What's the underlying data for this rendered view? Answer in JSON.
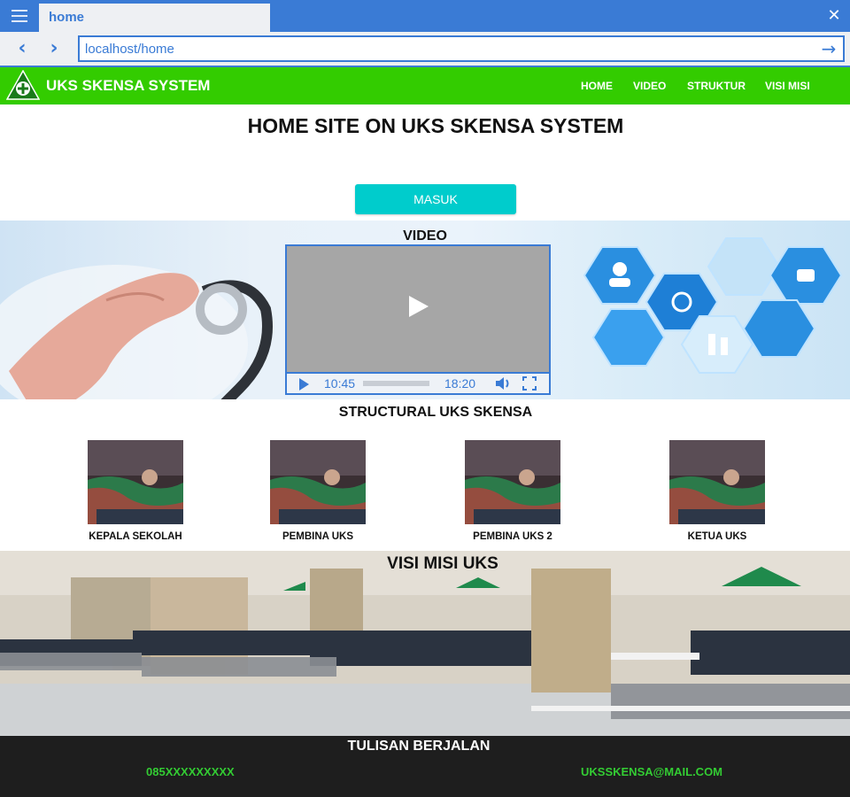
{
  "browser": {
    "tab_title": "home",
    "url": "localhost/home",
    "close_glyph": "✕",
    "back_glyph": "‹",
    "forward_glyph": "›",
    "go_glyph": "→"
  },
  "site": {
    "brand": "UKS SKENSA SYSTEM",
    "logo_text": "UKS",
    "nav": [
      "HOME",
      "VIDEO",
      "STRUKTUR",
      "VISI MISI"
    ]
  },
  "hero": {
    "title": "HOME SITE ON UKS SKENSA SYSTEM",
    "button_label": "MASUK"
  },
  "video": {
    "title": "VIDEO",
    "current_time": "10:45",
    "duration": "18:20",
    "progress": 0
  },
  "structure": {
    "title": "STRUCTURAL UKS SKENSA",
    "members": [
      {
        "name": "KEPALA SEKOLAH"
      },
      {
        "name": "PEMBINA UKS"
      },
      {
        "name": "PEMBINA UKS 2"
      },
      {
        "name": "KETUA UKS"
      }
    ]
  },
  "visi_misi": {
    "title": "VISI MISI UKS"
  },
  "footer": {
    "title": "TULISAN BERJALAN",
    "phone": "085XXXXXXXXX",
    "email": "UKSSKENSA@MAIL.COM"
  },
  "colors": {
    "browser_accent": "#3a7bd5",
    "header_green": "#33cc00",
    "button_teal": "#00cccc",
    "footer_bg": "#1e1e1e",
    "footer_text": "#33cc33"
  }
}
